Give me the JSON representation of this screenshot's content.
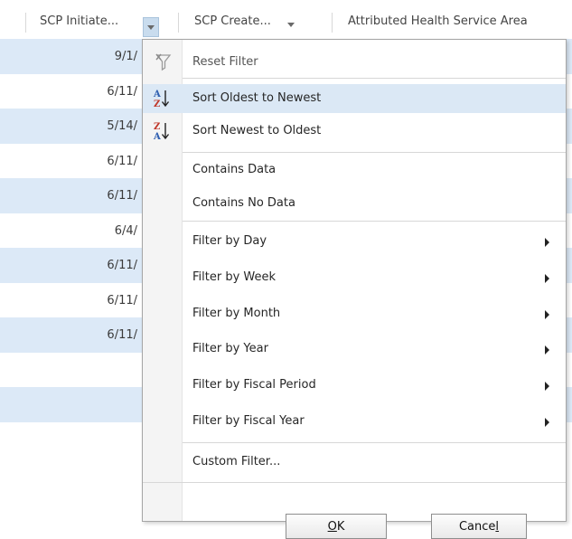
{
  "grid": {
    "columns": [
      {
        "label": "SCP Initiate..."
      },
      {
        "label": "SCP Create..."
      },
      {
        "label": "Attributed Health Service Area"
      }
    ],
    "rows": [
      "9/1/",
      "6/11/",
      "5/14/",
      "6/11/",
      "6/11/",
      "6/4/",
      "6/11/",
      "6/11/",
      "6/11/",
      "",
      ""
    ]
  },
  "menu": {
    "reset": "Reset Filter",
    "sort_asc": "Sort Oldest to Newest",
    "sort_desc": "Sort Newest to Oldest",
    "contains_data": "Contains Data",
    "contains_no_data": "Contains No Data",
    "filter_day": "Filter by Day",
    "filter_week": "Filter by Week",
    "filter_month": "Filter by Month",
    "filter_year": "Filter by Year",
    "filter_fiscal_period": "Filter by Fiscal Period",
    "filter_fiscal_year": "Filter by Fiscal Year",
    "custom_filter": "Custom Filter...",
    "ok_pre": "",
    "ok_key": "O",
    "ok_post": "K",
    "cancel_pre": "Cance",
    "cancel_key": "l",
    "cancel_post": ""
  },
  "colors": {
    "row_alt": "#dce9f7",
    "hover": "#dbe8f5",
    "filter_button": "#c9dcee"
  },
  "icons": {
    "reset": "filter-clear-icon",
    "sort_asc": "sort-a-z-icon",
    "sort_desc": "sort-z-a-icon",
    "submenu": "chevron-right-icon"
  }
}
